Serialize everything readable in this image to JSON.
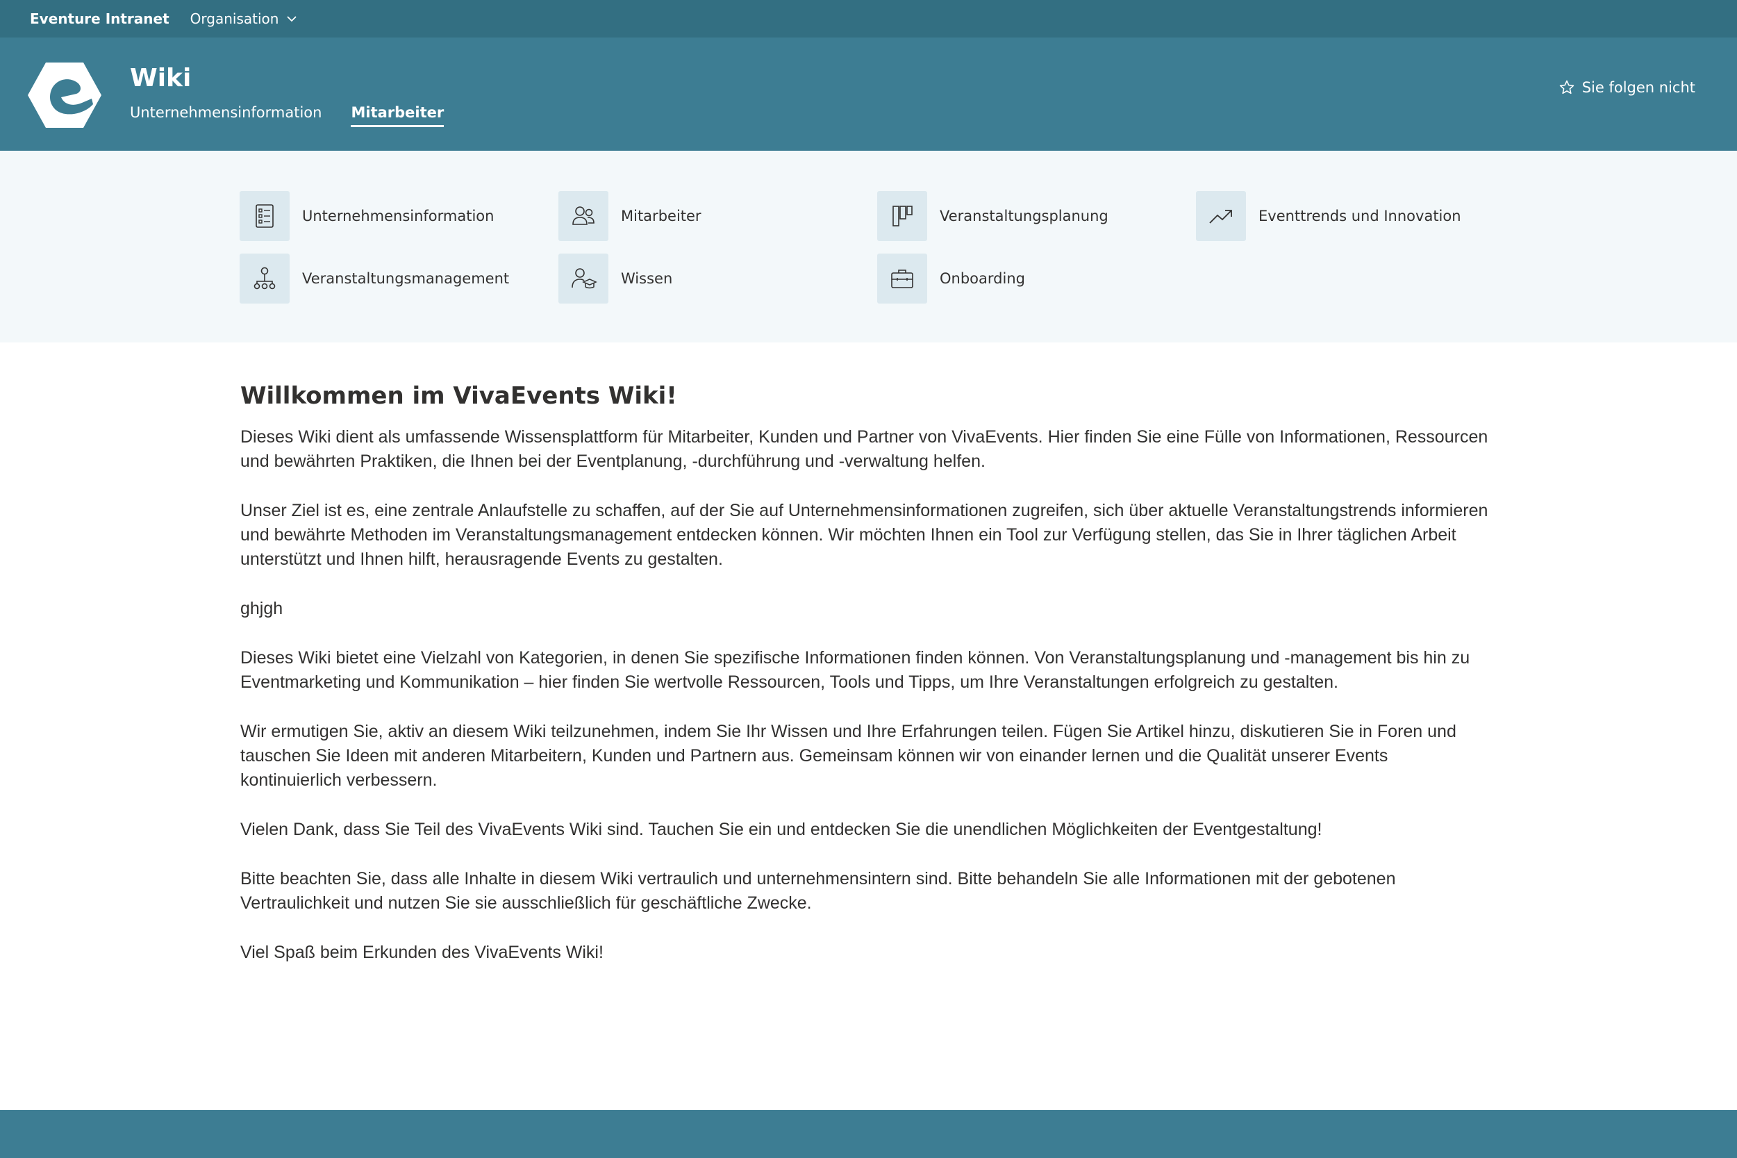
{
  "topbar": {
    "brand": "Eventure Intranet",
    "organisation_label": "Organisation"
  },
  "header": {
    "title": "Wiki",
    "tabs": [
      {
        "label": "Unternehmensinformation",
        "active": false
      },
      {
        "label": "Mitarbeiter",
        "active": true
      }
    ],
    "follow_label": "Sie folgen nicht"
  },
  "quick_links": [
    {
      "label": "Unternehmensinformation",
      "icon": "list-details-icon"
    },
    {
      "label": "Mitarbeiter",
      "icon": "people-icon"
    },
    {
      "label": "Veranstaltungsplanung",
      "icon": "board-icon"
    },
    {
      "label": "Eventtrends und Innovation",
      "icon": "trending-up-icon"
    },
    {
      "label": "Veranstaltungsmanagement",
      "icon": "org-chart-icon"
    },
    {
      "label": "Wissen",
      "icon": "person-learning-icon"
    },
    {
      "label": "Onboarding",
      "icon": "briefcase-icon"
    }
  ],
  "content": {
    "heading": "Willkommen im VivaEvents Wiki!",
    "paragraphs": [
      "Dieses Wiki dient als umfassende Wissensplattform für Mitarbeiter, Kunden und Partner von VivaEvents. Hier finden Sie eine Fülle von Informationen, Ressourcen und bewährten Praktiken, die Ihnen bei der Eventplanung, -durchführung und -verwaltung helfen.",
      "Unser Ziel ist es, eine zentrale Anlaufstelle zu schaffen, auf der Sie auf Unternehmensinformationen zugreifen, sich über aktuelle Veranstaltungstrends informieren und bewährte Methoden im Veranstaltungsmanagement entdecken können. Wir möchten Ihnen ein Tool zur Verfügung stellen, das Sie in Ihrer täglichen Arbeit unterstützt und Ihnen hilft, herausragende Events zu gestalten.",
      "ghjgh",
      "Dieses Wiki bietet eine Vielzahl von Kategorien, in denen Sie spezifische Informationen finden können. Von Veranstaltungsplanung und -management bis hin zu Eventmarketing und Kommunikation – hier finden Sie wertvolle Ressourcen, Tools und Tipps, um Ihre Veranstaltungen erfolgreich zu gestalten.",
      "Wir ermutigen Sie, aktiv an diesem Wiki teilzunehmen, indem Sie Ihr Wissen und Ihre Erfahrungen teilen. Fügen Sie Artikel hinzu, diskutieren Sie in Foren und tauschen Sie Ideen mit anderen Mitarbeitern, Kunden und Partnern aus. Gemeinsam können wir von einander lernen und die Qualität unserer Events kontinuierlich verbessern.",
      "Vielen Dank, dass Sie Teil des VivaEvents Wiki sind. Tauchen Sie ein und entdecken Sie die unendlichen Möglichkeiten der Eventgestaltung!",
      "Bitte beachten Sie, dass alle Inhalte in diesem Wiki vertraulich und unternehmensintern sind. Bitte behandeln Sie alle Informationen mit der gebotenen Vertraulichkeit und nutzen Sie sie ausschließlich für geschäftliche Zwecke.",
      "Viel Spaß beim Erkunden des VivaEvents Wiki!"
    ]
  },
  "colors": {
    "topbar": "#336f82",
    "header": "#3d7d93",
    "quicklinks_bg": "#f3f8fa",
    "icon_tile": "#dce9ef"
  }
}
